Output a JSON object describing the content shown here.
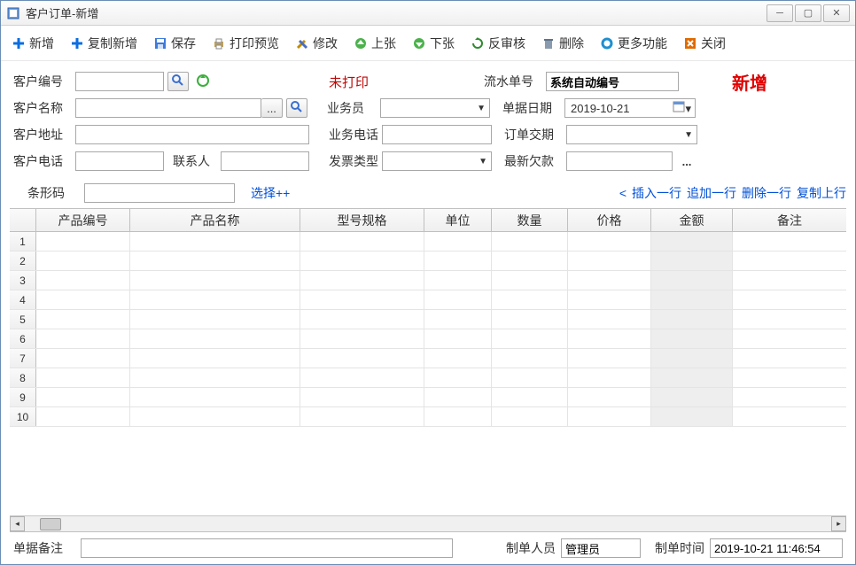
{
  "window": {
    "title": "客户订单-新增"
  },
  "toolbar": {
    "new": "新增",
    "copy_new": "复制新增",
    "save": "保存",
    "print_preview": "打印预览",
    "modify": "修改",
    "prev": "上张",
    "next": "下张",
    "unaudit": "反审核",
    "delete": "删除",
    "more": "更多功能",
    "close": "关闭"
  },
  "form": {
    "labels": {
      "cust_code": "客户编号",
      "cust_name": "客户名称",
      "cust_addr": "客户地址",
      "cust_tel": "客户电话",
      "contact": "联系人",
      "not_printed": "未打印",
      "salesman": "业务员",
      "biz_tel": "业务电话",
      "invoice_type": "发票类型",
      "serial_no": "流水单号",
      "doc_date": "单据日期",
      "delivery_date": "订单交期",
      "latest_arrears": "最新欠款",
      "status_new": "新增"
    },
    "values": {
      "cust_code": "",
      "cust_name": "",
      "cust_addr": "",
      "cust_tel": "",
      "contact": "",
      "salesman": "",
      "biz_tel": "",
      "invoice_type": "",
      "serial_no": "系统自动编号",
      "doc_date": "2019-10-21",
      "delivery_date": "",
      "latest_arrears": ""
    }
  },
  "barcode": {
    "label": "条形码",
    "value": "",
    "select_link": "选择++"
  },
  "row_ops": {
    "insert_marker": "<",
    "insert": "插入一行",
    "append": "追加一行",
    "delete": "删除一行",
    "copy_prev": "复制上行"
  },
  "grid": {
    "headers": [
      "产品编号",
      "产品名称",
      "型号规格",
      "单位",
      "数量",
      "价格",
      "金额",
      "备注"
    ],
    "rows": [
      1,
      2,
      3,
      4,
      5,
      6,
      7,
      8,
      9,
      10
    ]
  },
  "footer": {
    "remark_label": "单据备注",
    "remark_value": "",
    "maker_label": "制单人员",
    "maker_value": "管理员",
    "make_time_label": "制单时间",
    "make_time_value": "2019-10-21 11:46:54"
  },
  "ellipsis_btn": "..."
}
